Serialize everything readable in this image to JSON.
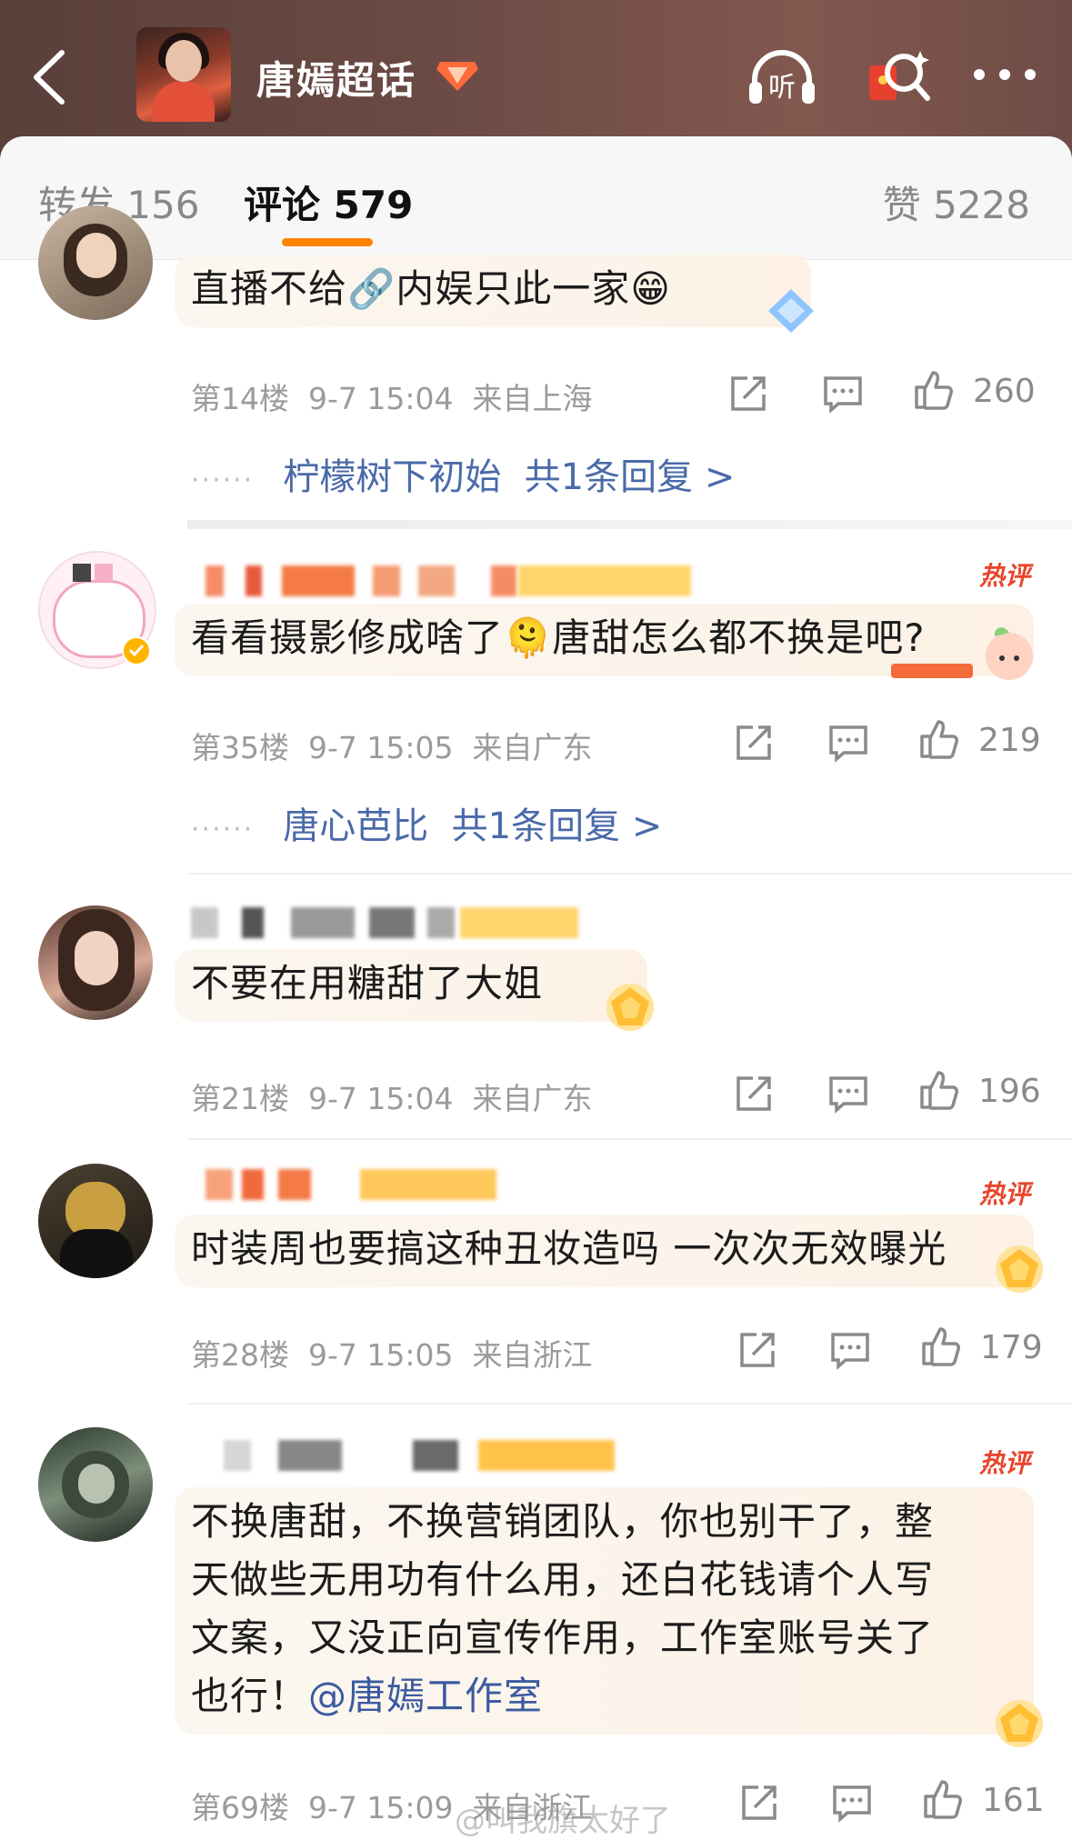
{
  "header": {
    "title": "唐嫣超话",
    "back_icon": "chevron-left-icon",
    "listen_icon": "headphone-listen-icon",
    "listen_label": "听",
    "redpacket_icon": "red-packet-search-icon",
    "more_icon": "more-dots-icon"
  },
  "tabs": {
    "repost": "转发 156",
    "comment": "评论 579",
    "like": "赞 5228",
    "accent": "#ff8200"
  },
  "comments": [
    {
      "text": "直播不给🔗内娱只此一家😁",
      "floor": "第14楼",
      "time": "9-7 15:04",
      "location": "来自上海",
      "likes": "260",
      "reply_user": "柠檬树下初始",
      "reply_count": "共1条回复 >"
    },
    {
      "hot_label": "热评",
      "text": "看看摄影修成啥了🫠唐甜怎么都不换是吧?",
      "floor": "第35楼",
      "time": "9-7 15:05",
      "location": "来自广东",
      "likes": "219",
      "reply_user": "唐心芭比",
      "reply_count": "共1条回复 >"
    },
    {
      "text": "不要在用糖甜了大姐",
      "floor": "第21楼",
      "time": "9-7 15:04",
      "location": "来自广东",
      "likes": "196"
    },
    {
      "hot_label": "热评",
      "text": "时装周也要搞这种丑妆造吗 一次次无效曝光",
      "floor": "第28楼",
      "time": "9-7 15:05",
      "location": "来自浙江",
      "likes": "179"
    },
    {
      "hot_label": "热评",
      "text_lines": [
        "不换唐甜，不换营销团队，你也别干了，整",
        "天做些无用功有什么用，还白花钱请个人写",
        "文案，又没正向宣传作用，工作室账号关了",
        "也行！"
      ],
      "mention": "@唐嫣工作室",
      "floor": "第69楼",
      "time": "9-7 15:09",
      "location": "来自浙江",
      "likes": "161"
    }
  ],
  "watermark": "@叫我旗太好了",
  "colors": {
    "link": "#4a6aa8",
    "hot": "#e8452a",
    "meta": "#9b9b9b"
  }
}
